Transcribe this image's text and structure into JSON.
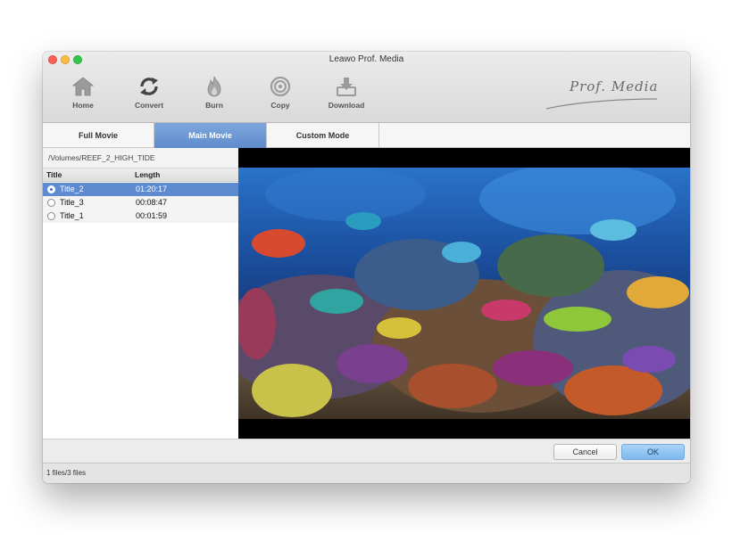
{
  "window": {
    "title": "Leawo Prof. Media"
  },
  "toolbar": {
    "items": [
      {
        "label": "Home",
        "icon": "home-icon"
      },
      {
        "label": "Convert",
        "icon": "convert-icon"
      },
      {
        "label": "Burn",
        "icon": "burn-icon"
      },
      {
        "label": "Copy",
        "icon": "copy-icon"
      },
      {
        "label": "Download",
        "icon": "download-icon"
      }
    ]
  },
  "logo": {
    "text": "Prof. Media"
  },
  "tabs": [
    {
      "label": "Full Movie",
      "active": false
    },
    {
      "label": "Main Movie",
      "active": true
    },
    {
      "label": "Custom Mode",
      "active": false
    }
  ],
  "source": {
    "path": "/Volumes/REEF_2_HIGH_TIDE"
  },
  "title_list": {
    "columns": [
      "Title",
      "Length"
    ],
    "rows": [
      {
        "title": "Title_2",
        "length": "01:20:17",
        "selected": true
      },
      {
        "title": "Title_3",
        "length": "00:08:47",
        "selected": false
      },
      {
        "title": "Title_1",
        "length": "00:01:59",
        "selected": false
      }
    ]
  },
  "buttons": {
    "cancel": "Cancel",
    "ok": "OK"
  },
  "status": {
    "text": "1 files/3 files"
  },
  "colors": {
    "accent": "#5e8ad0",
    "tab_active": "#6f98d4",
    "ok_button": "#8cc2f2"
  }
}
